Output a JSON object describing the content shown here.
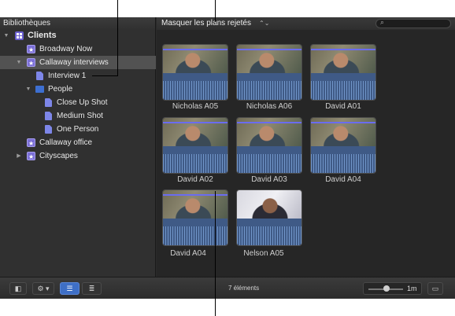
{
  "sidebar": {
    "header": "Bibliothèques",
    "items": [
      {
        "label": "Clients",
        "icon": "library-grid-icon",
        "expanded": true,
        "bold": true
      },
      {
        "label": "Broadway Now",
        "icon": "event-star-icon"
      },
      {
        "label": "Callaway interviews",
        "icon": "event-star-icon",
        "expanded": true,
        "selected": true
      },
      {
        "label": "Interview 1",
        "icon": "clip-icon"
      },
      {
        "label": "People",
        "icon": "folder-icon",
        "expanded": true
      },
      {
        "label": "Close Up Shot",
        "icon": "keyword-icon"
      },
      {
        "label": "Medium Shot",
        "icon": "keyword-icon"
      },
      {
        "label": "One Person",
        "icon": "keyword-icon"
      },
      {
        "label": "Callaway office",
        "icon": "event-star-icon"
      },
      {
        "label": "Cityscapes",
        "icon": "event-star-icon",
        "expanded": false
      }
    ]
  },
  "browser": {
    "filter_label": "Masquer les plans rejetés",
    "filter_arrows": "⌃⌄",
    "search_icon": "⌕",
    "clips": [
      {
        "label": "Nicholas A05"
      },
      {
        "label": "Nicholas A06"
      },
      {
        "label": "David A01"
      },
      {
        "label": "David A02"
      },
      {
        "label": "David A03"
      },
      {
        "label": "David A04"
      },
      {
        "label": "David A04"
      },
      {
        "label": "Nelson A05"
      }
    ]
  },
  "toolbar": {
    "count": "7 éléments",
    "zoom_value": "1m",
    "action_glyph": "⚙ ▾",
    "view_icons": [
      "filmstrip-view-icon",
      "list-view-icon"
    ]
  },
  "colors": {
    "accent": "#3e6fc6",
    "event_icon": "#7b6fd6",
    "waveform": "#3f5a86",
    "selection": "#525252"
  }
}
